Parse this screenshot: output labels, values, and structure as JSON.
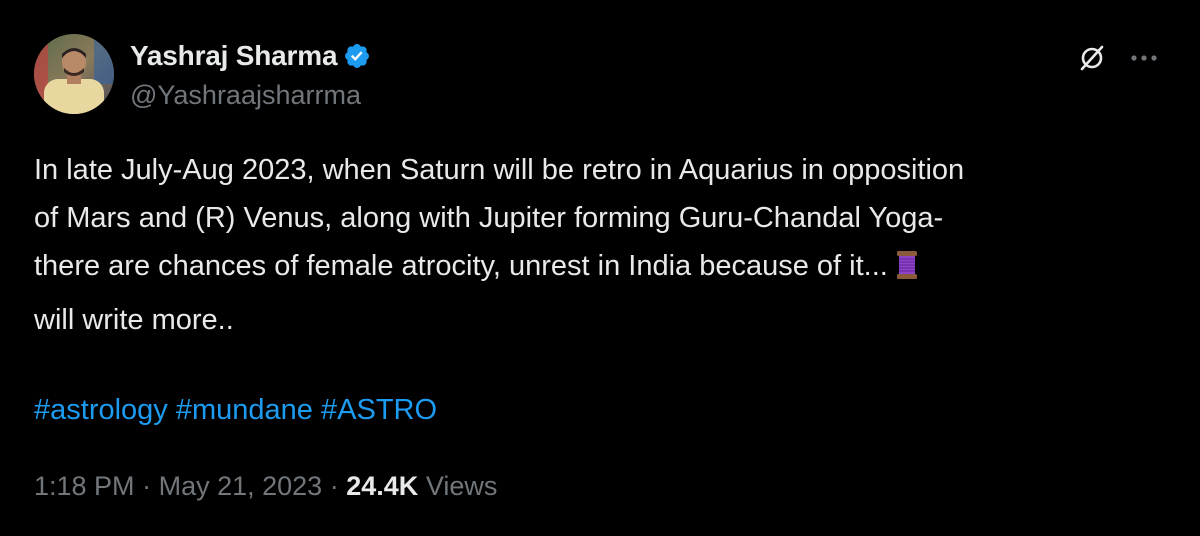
{
  "author": {
    "display_name": "Yashraj Sharma",
    "handle": "@Yashraajsharrma",
    "verified_icon": "verified-badge-icon"
  },
  "actions": {
    "grok_icon": "grok-icon",
    "more_icon": "more-options-icon"
  },
  "tweet": {
    "lines": [
      "In late July-Aug 2023, when Saturn will be retro in Aquarius in opposition",
      "of Mars and (R) Venus, along with Jupiter forming Guru-Chandal Yoga-",
      "there are chances of female atrocity, unrest in India because of it...",
      "will write more.."
    ],
    "emoji_icon": "thread-spool-icon",
    "hashtags": [
      "#astrology",
      "#mundane",
      "#ASTRO"
    ]
  },
  "meta": {
    "time": "1:18 PM",
    "separator": "·",
    "date": "May 21, 2023",
    "views_count": "24.4K",
    "views_label": "Views"
  },
  "colors": {
    "background": "#000000",
    "primary_text": "#e7e9ea",
    "secondary_text": "#71767b",
    "link": "#1d9bf0",
    "verified": "#1d9bf0"
  }
}
